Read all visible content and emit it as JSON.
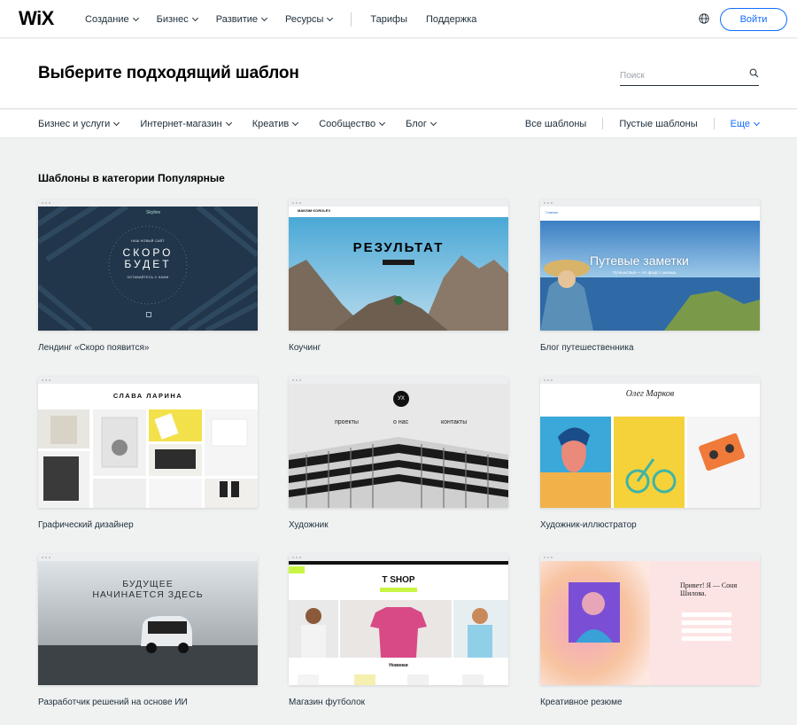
{
  "logo": "WiX",
  "nav": {
    "items": [
      "Создание",
      "Бизнес",
      "Развитие",
      "Ресурсы"
    ],
    "links": [
      "Тарифы",
      "Поддержка"
    ],
    "login": "Войти"
  },
  "hero": {
    "title": "Выберите подходящий шаблон",
    "search_placeholder": "Поиск"
  },
  "categories": {
    "left": [
      "Бизнес и услуги",
      "Интернет-магазин",
      "Креатив",
      "Сообщество",
      "Блог"
    ],
    "right": [
      "Все шаблоны",
      "Пустые шаблоны"
    ],
    "more": "Еще"
  },
  "section_title": "Шаблоны в категории Популярные",
  "templates": [
    {
      "label": "Лендинг «Скоро появится»",
      "headline": "СКОРО БУДЕТ",
      "sub": "НАШ НОВЫЙ САЙТ",
      "sub2": "ОСТАВАЙТЕСЬ С НАМИ"
    },
    {
      "label": "Коучинг",
      "headline": "РЕЗУЛЬТАТ",
      "brand": "MAKSIM KOROLEV"
    },
    {
      "label": "Блог путешественника",
      "headline": "Путевые заметки",
      "sub": "Путешествия — это флирт с жизнью"
    },
    {
      "label": "Графический дизайнер",
      "headline": "СЛАВА ЛАРИНА"
    },
    {
      "label": "Художник",
      "logo": "УХ",
      "menu": [
        "проекты",
        "о нас",
        "контакты"
      ]
    },
    {
      "label": "Художник-иллюстратор",
      "headline": "Олег Марков"
    },
    {
      "label": "Разработчик решений на основе ИИ",
      "headline": "БУДУЩЕЕ НАЧИНАЕТСЯ ЗДЕСЬ"
    },
    {
      "label": "Магазин футболок",
      "headline": "T SHOP",
      "sub": "Новинки"
    },
    {
      "label": "Креативное резюме",
      "headline": "Привет! Я — Соня Шилова."
    }
  ],
  "colors": {
    "accent": "#116dff",
    "bg": "#f0f2f2"
  }
}
